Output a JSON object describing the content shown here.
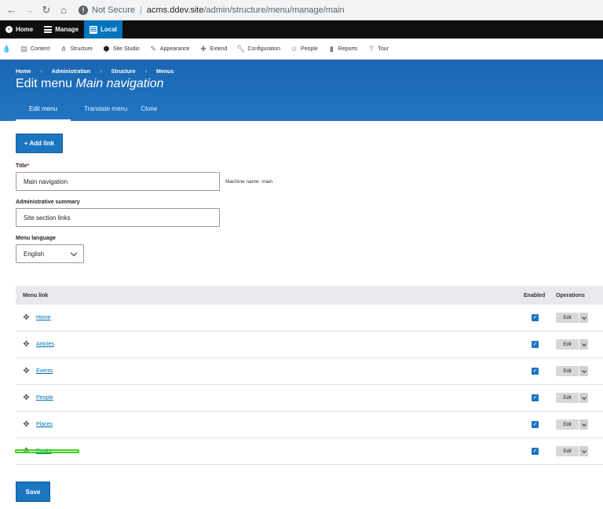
{
  "browser": {
    "security_label": "Not Secure",
    "url_host": "acms.ddev.site",
    "url_path": "/admin/structure/menu/manage/main"
  },
  "toolbar": {
    "home": "Home",
    "manage": "Manage",
    "local": "Local"
  },
  "tray": {
    "items": [
      "Content",
      "Structure",
      "Site Studio",
      "Appearance",
      "Extend",
      "Configuration",
      "People",
      "Reports",
      "Tour"
    ]
  },
  "header": {
    "breadcrumb": [
      "Home",
      "Administration",
      "Structure",
      "Menus"
    ],
    "title_prefix": "Edit menu",
    "title_name": "Main navigation",
    "tabs": [
      "Edit menu",
      "Translate menu",
      "Clone"
    ]
  },
  "form": {
    "add_link": "+ Add link",
    "title_label": "Title",
    "title_value": "Main navigation",
    "machine_name": "Machine name: main",
    "summary_label": "Administrative summary",
    "summary_value": "Site section links",
    "language_label": "Menu language",
    "language_value": "English",
    "save": "Save"
  },
  "table": {
    "headers": {
      "link": "Menu link",
      "enabled": "Enabled",
      "operations": "Operations"
    },
    "rows": [
      {
        "label": "Home",
        "enabled": true,
        "op": "Edit"
      },
      {
        "label": "Articles",
        "enabled": true,
        "op": "Edit"
      },
      {
        "label": "Events",
        "enabled": true,
        "op": "Edit"
      },
      {
        "label": "People",
        "enabled": true,
        "op": "Edit"
      },
      {
        "label": "Places",
        "enabled": true,
        "op": "Edit"
      },
      {
        "label": "Books",
        "enabled": true,
        "op": "Edit"
      }
    ]
  },
  "colors": {
    "accent": "#1b76c0",
    "toolbar": "#0f0f0f",
    "highlight": "#39d31a"
  }
}
